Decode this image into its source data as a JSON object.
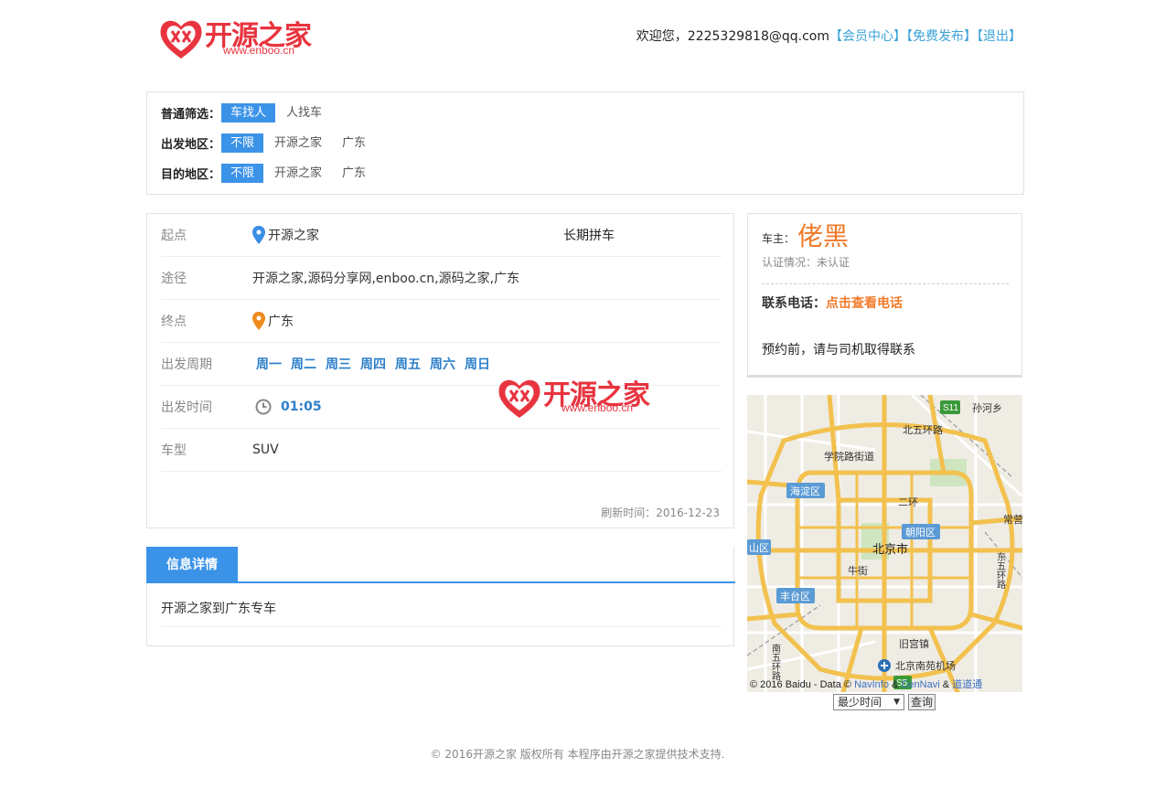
{
  "header": {
    "logo_text": "开源之家",
    "logo_url": "www.enboo.cn",
    "welcome": "欢迎您，2225329818@qq.com",
    "links": [
      "【会员中心】",
      "【免费发布】",
      "【退出】"
    ]
  },
  "filter": {
    "rows": [
      {
        "label": "普通筛选：",
        "options": [
          "车找人",
          "人找车"
        ],
        "active": 0
      },
      {
        "label": "出发地区：",
        "options": [
          "不限",
          "开源之家",
          "广东"
        ],
        "active": 0
      },
      {
        "label": "目的地区：",
        "options": [
          "不限",
          "开源之家",
          "广东"
        ],
        "active": 0
      }
    ]
  },
  "route": {
    "start_label": "起点",
    "start_value": "开源之家",
    "trip_type": "长期拼车",
    "via_label": "途径",
    "via_value": "开源之家,源码分享网,enboo.cn,源码之家,广东",
    "end_label": "终点",
    "end_value": "广东",
    "cycle_label": "出发周期",
    "weekdays": [
      "周一",
      "周二",
      "周三",
      "周四",
      "周五",
      "周六",
      "周日"
    ],
    "time_label": "出发时间",
    "time_value": "01:05",
    "car_label": "车型",
    "car_value": "SUV",
    "refresh": "刷新时间：2016-12-23"
  },
  "details": {
    "tab": "信息详情",
    "body": "开源之家到广东专车"
  },
  "owner": {
    "label": "车主：",
    "name": "佬黑",
    "cert": "认证情况：未认证",
    "phone_label": "联系电话：",
    "phone_link": "点击查看电话",
    "note": "预约前，请与司机取得联系"
  },
  "map": {
    "labels": {
      "beiwuhuan": "北五环路",
      "xueyuan": "学院路街道",
      "haidian": "海淀区",
      "erhuan": "二环",
      "chaoyang": "朝阳区",
      "beijing": "北京市",
      "shan": "山区",
      "niujie": "牛街",
      "fengtai": "丰台区",
      "jiugong": "旧宫镇",
      "nanyuan": "北京南苑机场",
      "sunhe": "孙河乡",
      "chang": "常营",
      "dongwuhuan": "东五环路",
      "nanwuhuan": "南五环路",
      "s11": "S11",
      "s5": "S5"
    },
    "copyright": "© 2016 Baidu - Data ©",
    "copy_link1": "NavInfo",
    "copy_amp": "&",
    "copy_link2": "CenNavi",
    "copy_amp2": "&",
    "copy_link3": "道道通",
    "select_value": "最少时间",
    "query_button": "查询"
  },
  "footer": "© 2016开源之家 版权所有 本程序由开源之家提供技术支持."
}
